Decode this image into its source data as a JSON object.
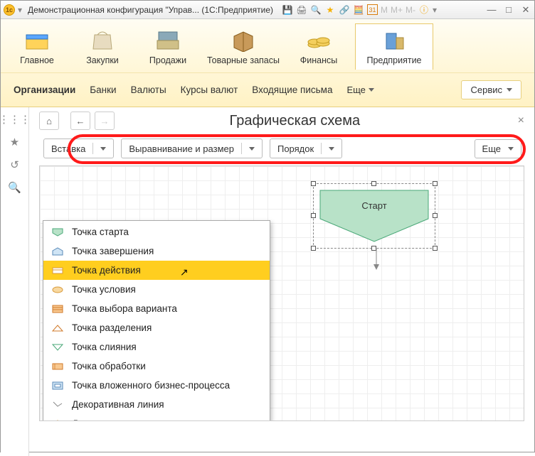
{
  "titlebar": {
    "title": "Демонстрационная конфигурация \"Управ... (1С:Предприятие)"
  },
  "ribbon": {
    "tabs": [
      {
        "label": "Главное"
      },
      {
        "label": "Закупки"
      },
      {
        "label": "Продажи"
      },
      {
        "label": "Товарные запасы"
      },
      {
        "label": "Финансы"
      },
      {
        "label": "Предприятие"
      }
    ],
    "subnav": {
      "items": [
        "Организации",
        "Банки",
        "Валюты",
        "Курсы валют",
        "Входящие письма"
      ],
      "more": "Еще",
      "service": "Сервис"
    }
  },
  "page": {
    "title": "Графическая схема"
  },
  "toolbar": {
    "insert": "Вставка",
    "align": "Выравнивание и размер",
    "order": "Порядок",
    "more": "Еще"
  },
  "shape": {
    "start_label": "Старт"
  },
  "insert_menu": {
    "items": [
      {
        "label": "Точка старта",
        "icon": "start-point-icon"
      },
      {
        "label": "Точка завершения",
        "icon": "end-point-icon"
      },
      {
        "label": "Точка действия",
        "icon": "action-point-icon"
      },
      {
        "label": "Точка условия",
        "icon": "condition-point-icon"
      },
      {
        "label": "Точка выбора варианта",
        "icon": "choice-point-icon"
      },
      {
        "label": "Точка разделения",
        "icon": "split-point-icon"
      },
      {
        "label": "Точка слияния",
        "icon": "merge-point-icon"
      },
      {
        "label": "Точка обработки",
        "icon": "process-point-icon"
      },
      {
        "label": "Точка вложенного бизнес-процесса",
        "icon": "subprocess-point-icon"
      },
      {
        "label": "Декоративная линия",
        "icon": "decor-line-icon"
      },
      {
        "label": "Декорация",
        "icon": "decoration-icon"
      }
    ],
    "hover_index": 2
  }
}
